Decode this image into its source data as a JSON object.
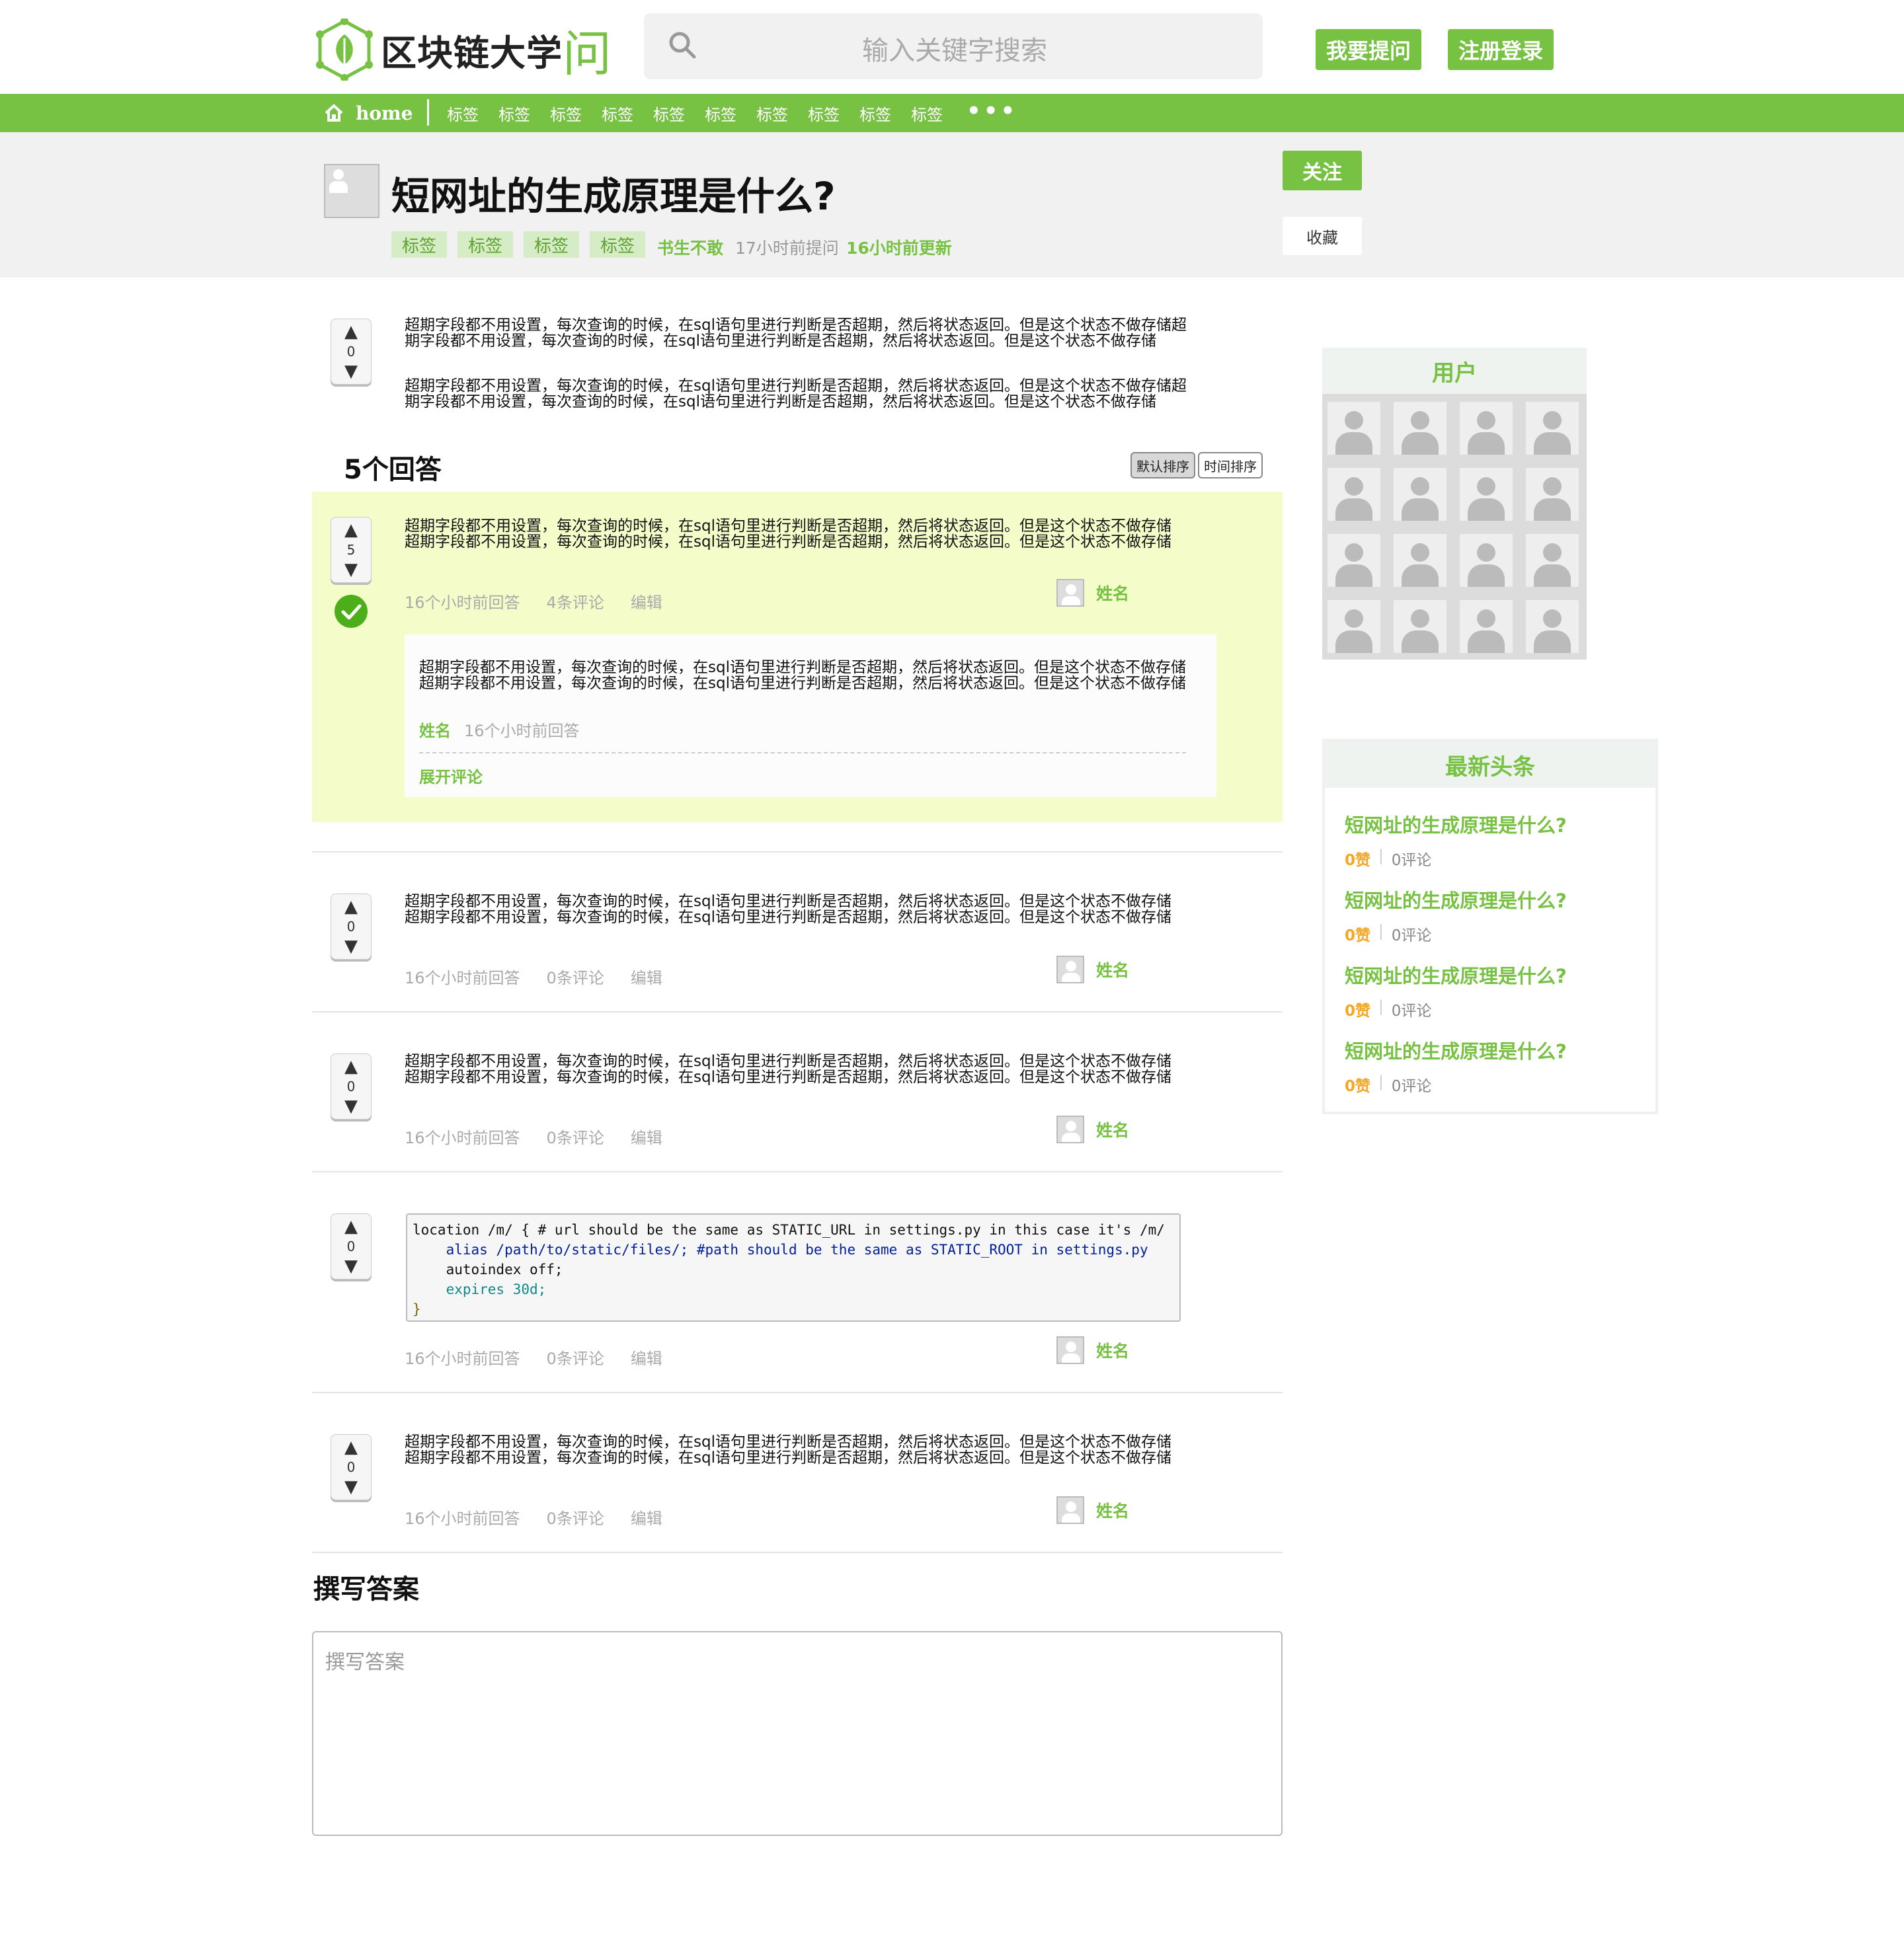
{
  "header": {
    "logo_text": "区块链大学",
    "logo_char": "问",
    "search_placeholder": "输入关键字搜索",
    "ask_button": "我要提问",
    "login_button": "注册登录"
  },
  "nav": {
    "home": "home",
    "tags": [
      "标签",
      "标签",
      "标签",
      "标签",
      "标签",
      "标签",
      "标签",
      "标签",
      "标签",
      "标签"
    ],
    "more": "•••"
  },
  "question": {
    "title": "短网址的生成原理是什么?",
    "tags": [
      "标签",
      "标签",
      "标签",
      "标签"
    ],
    "author": "书生不敢",
    "asked": "17小时前提问",
    "updated": "16小时前更新",
    "follow_button": "关注",
    "favorite_button": "收藏",
    "votes": "0",
    "body": [
      "超期字段都不用设置，每次查询的时候，在sql语句里进行判断是否超期，然后将状态返回。但是这个状态不做存储超期字段都不用设置，每次查询的时候，在sql语句里进行判断是否超期，然后将状态返回。但是这个状态不做存储",
      "超期字段都不用设置，每次查询的时候，在sql语句里进行判断是否超期，然后将状态返回。但是这个状态不做存储超期字段都不用设置，每次查询的时候，在sql语句里进行判断是否超期，然后将状态返回。但是这个状态不做存储"
    ]
  },
  "answers_header": {
    "title": "5个回答",
    "sort_default": "默认排序",
    "sort_time": "时间排序"
  },
  "answers": [
    {
      "votes": "5",
      "body": "超期字段都不用设置，每次查询的时候，在sql语句里进行判断是否超期，然后将状态返回。但是这个状态不做存储超期字段都不用设置，每次查询的时候，在sql语句里进行判断是否超期，然后将状态返回。但是这个状态不做存储",
      "time": "16个小时前回答",
      "comments": "4条评论",
      "edit": "编辑",
      "user": "姓名",
      "comment": {
        "body": "超期字段都不用设置，每次查询的时候，在sql语句里进行判断是否超期，然后将状态返回。但是这个状态不做存储超期字段都不用设置，每次查询的时候，在sql语句里进行判断是否超期，然后将状态返回。但是这个状态不做存储",
        "user": "姓名",
        "time": "16个小时前回答",
        "expand": "展开评论"
      }
    },
    {
      "votes": "0",
      "body": "超期字段都不用设置，每次查询的时候，在sql语句里进行判断是否超期，然后将状态返回。但是这个状态不做存储超期字段都不用设置，每次查询的时候，在sql语句里进行判断是否超期，然后将状态返回。但是这个状态不做存储",
      "time": "16个小时前回答",
      "comments": "0条评论",
      "edit": "编辑",
      "user": "姓名"
    },
    {
      "votes": "0",
      "body": "超期字段都不用设置，每次查询的时候，在sql语句里进行判断是否超期，然后将状态返回。但是这个状态不做存储超期字段都不用设置，每次查询的时候，在sql语句里进行判断是否超期，然后将状态返回。但是这个状态不做存储",
      "time": "16个小时前回答",
      "comments": "0条评论",
      "edit": "编辑",
      "user": "姓名"
    },
    {
      "votes": "0",
      "code": [
        "location /m/ { # url should be the same as STATIC_URL in settings.py in this case it's /m/",
        "    alias /path/to/static/files/; #path should be the same as STATIC_ROOT in settings.py",
        "    autoindex off;",
        "    expires 30d;",
        "}"
      ],
      "time": "16个小时前回答",
      "comments": "0条评论",
      "edit": "编辑",
      "user": "姓名"
    },
    {
      "votes": "0",
      "body": "超期字段都不用设置，每次查询的时候，在sql语句里进行判断是否超期，然后将状态返回。但是这个状态不做存储超期字段都不用设置，每次查询的时候，在sql语句里进行判断是否超期，然后将状态返回。但是这个状态不做存储",
      "time": "16个小时前回答",
      "comments": "0条评论",
      "edit": "编辑",
      "user": "姓名"
    }
  ],
  "write_answer": {
    "title": "撰写答案",
    "placeholder": "撰写答案"
  },
  "sidebar": {
    "users_title": "用户",
    "news_title": "最新头条",
    "news": [
      {
        "title": "短网址的生成原理是什么?",
        "likes": "0赞",
        "comments": "0评论"
      },
      {
        "title": "短网址的生成原理是什么?",
        "likes": "0赞",
        "comments": "0评论"
      },
      {
        "title": "短网址的生成原理是什么?",
        "likes": "0赞",
        "comments": "0评论"
      },
      {
        "title": "短网址的生成原理是什么?",
        "likes": "0赞",
        "comments": "0评论"
      }
    ]
  },
  "colors": {
    "brand": "#77c143",
    "best_answer_bg": "#f4fcc9",
    "likes": "#f5a623"
  }
}
